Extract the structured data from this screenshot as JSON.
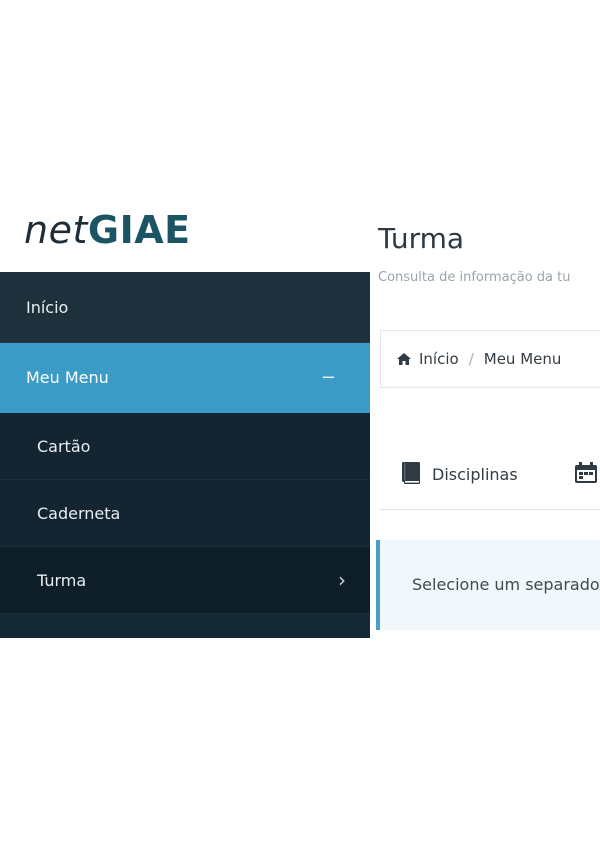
{
  "logo": {
    "prefix": "net",
    "brand": "GIAE"
  },
  "sidebar": {
    "items": [
      {
        "label": "Início",
        "type": "top"
      },
      {
        "label": "Meu Menu",
        "type": "active",
        "toggle": "−"
      },
      {
        "label": "Cartão",
        "type": "sub"
      },
      {
        "label": "Caderneta",
        "type": "sub"
      },
      {
        "label": "Turma",
        "type": "sub-current",
        "chevron": "›"
      }
    ]
  },
  "header": {
    "title": "Turma",
    "subtitle": "Consulta de informação da tu"
  },
  "breadcrumb": {
    "items": [
      "Início",
      "Meu Menu"
    ],
    "separator": "/"
  },
  "tabs": [
    {
      "label": "Disciplinas",
      "icon": "book-icon"
    },
    {
      "label": "",
      "icon": "calendar-icon"
    }
  ],
  "alert": {
    "text": "Selecione um separador"
  },
  "colors": {
    "sidebar_bg": "#1b2b38",
    "active_bg": "#3a9bc7",
    "brand": "#1b5563",
    "alert_border": "#4a9ec9"
  }
}
